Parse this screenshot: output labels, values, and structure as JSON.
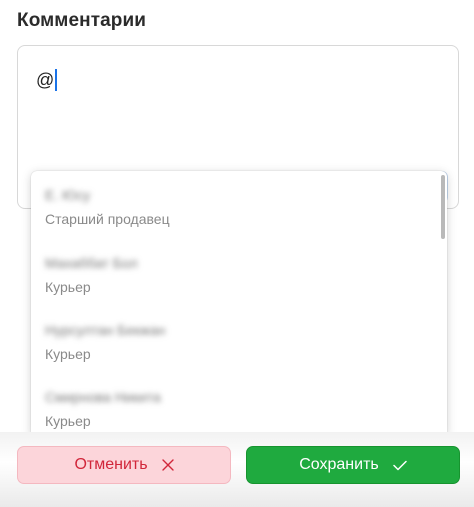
{
  "section": {
    "title": "Комментарии"
  },
  "comment": {
    "value": "@"
  },
  "mentions": {
    "items": [
      {
        "name": "Е. Юсу",
        "role": "Старший продавец"
      },
      {
        "name": "Махаббат Бол",
        "role": "Курьер"
      },
      {
        "name": "Нурсултан Бекжан",
        "role": "Курьер"
      },
      {
        "name": "Смирнова Никита",
        "role": "Курьер"
      }
    ]
  },
  "actions": {
    "cancel_label": "Отменить",
    "save_label": "Сохранить"
  },
  "colors": {
    "caret": "#1a73e8",
    "cancel_bg": "#fcd5da",
    "cancel_text": "#d1263a",
    "save_bg": "#1faa3f",
    "save_text": "#ffffff"
  },
  "icons": {
    "cancel": "close-icon",
    "save": "checkmark-icon"
  }
}
